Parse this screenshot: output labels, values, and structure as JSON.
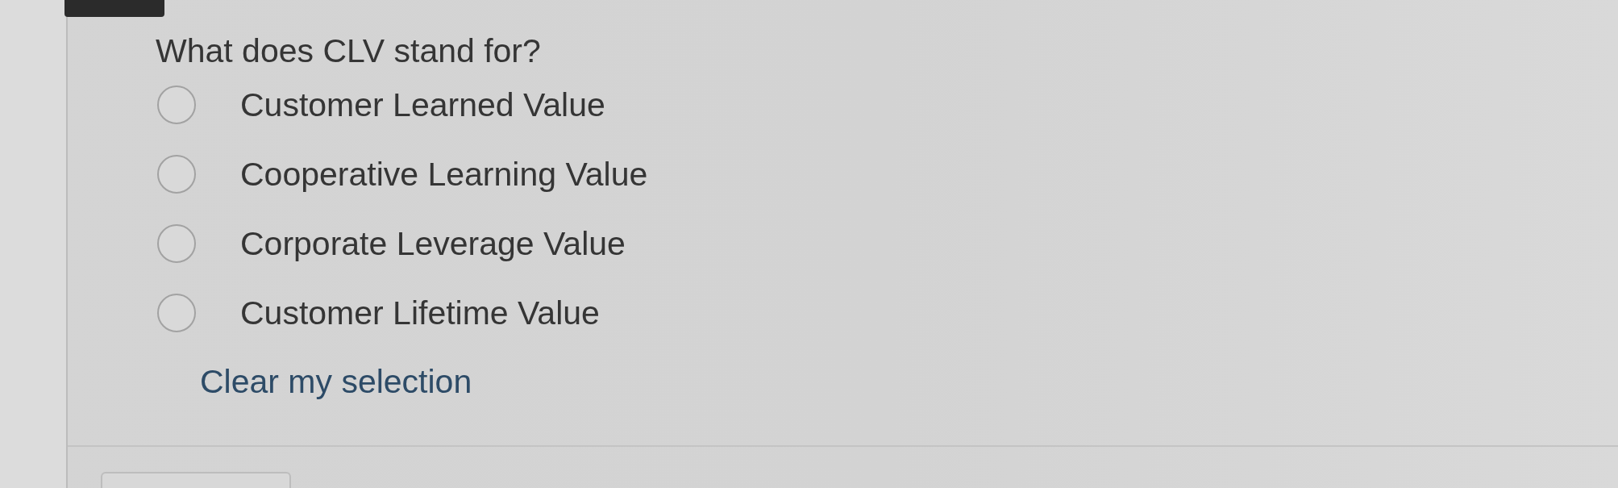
{
  "question": {
    "text": "What does CLV stand for?",
    "options": [
      {
        "label": "Customer Learned Value",
        "selected": false
      },
      {
        "label": "Cooperative Learning Value",
        "selected": false
      },
      {
        "label": "Corporate Leverage Value",
        "selected": false
      },
      {
        "label": "Customer Lifetime Value",
        "selected": false
      }
    ],
    "clear_link": "Clear my selection"
  }
}
